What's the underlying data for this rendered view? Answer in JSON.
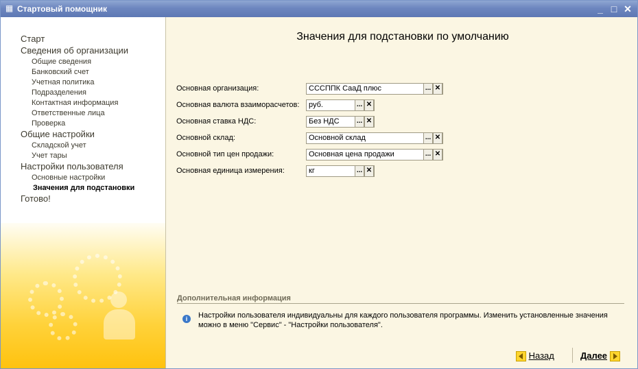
{
  "window": {
    "title": "Стартовый помощник"
  },
  "sidebar": {
    "items": [
      {
        "label": "Старт",
        "level": 1
      },
      {
        "label": "Сведения об организации",
        "level": 1
      },
      {
        "label": "Общие сведения",
        "level": 2
      },
      {
        "label": "Банковский счет",
        "level": 2
      },
      {
        "label": "Учетная политика",
        "level": 2
      },
      {
        "label": "Подразделения",
        "level": 2
      },
      {
        "label": "Контактная информация",
        "level": 2
      },
      {
        "label": "Ответственные лица",
        "level": 2
      },
      {
        "label": "Проверка",
        "level": 2
      },
      {
        "label": "Общие настройки",
        "level": 1
      },
      {
        "label": "Складской учет",
        "level": 2
      },
      {
        "label": "Учет тары",
        "level": 2
      },
      {
        "label": "Настройки пользователя",
        "level": 1
      },
      {
        "label": "Основные настройки",
        "level": 2
      },
      {
        "label": "Значения для подстановки",
        "level": 2,
        "active": true
      },
      {
        "label": "Готово!",
        "level": 1
      }
    ]
  },
  "main": {
    "title": "Значения для подстановки по умолчанию",
    "fields": [
      {
        "label": "Основная организация:",
        "value": "СССППК СааД плюс"
      },
      {
        "label": "Основная валюта взаиморасчетов:",
        "value": "руб."
      },
      {
        "label": "Основная ставка НДС:",
        "value": "Без НДС"
      },
      {
        "label": "Основной склад:",
        "value": "Основной склад"
      },
      {
        "label": "Основной тип цен продажи:",
        "value": "Основная цена продажи"
      },
      {
        "label": "Основная единица измерения:",
        "value": "кг"
      }
    ],
    "select_button": "...",
    "clear_button": "✕"
  },
  "info": {
    "heading": "Дополнительная информация",
    "text": "Настройки пользователя индивидуальны для каждого пользователя программы. Изменить установленные значения можно в меню \"Сервис\" - \"Настройки пользователя\"."
  },
  "buttons": {
    "back": "Назад",
    "next": "Далее"
  },
  "colors": {
    "titlebar": "#6d86bf",
    "panel": "#fbf6e3",
    "accent": "#ffc20e"
  }
}
